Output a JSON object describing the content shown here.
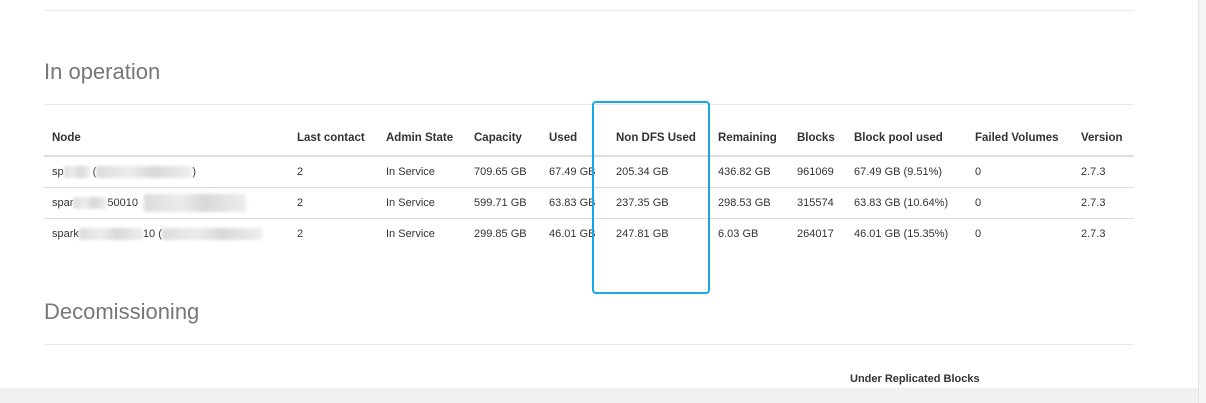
{
  "sections": {
    "in_operation": "In operation",
    "decommissioning": "Decomissioning"
  },
  "table": {
    "headers": [
      "Node",
      "Last contact",
      "Admin State",
      "Capacity",
      "Used",
      "Non DFS Used",
      "Remaining",
      "Blocks",
      "Block pool used",
      "Failed Volumes",
      "Version"
    ],
    "rows": [
      {
        "node_prefix": "sp",
        "node_mid": "",
        "node_suffix": ")",
        "last_contact": "2",
        "admin_state": "In Service",
        "capacity": "709.65 GB",
        "used": "67.49 GB",
        "non_dfs_used": "205.34 GB",
        "remaining": "436.82 GB",
        "blocks": "961069",
        "block_pool_used": "67.49 GB (9.51%)",
        "failed_volumes": "0",
        "version": "2.7.3"
      },
      {
        "node_prefix": "spar",
        "node_mid": "50010",
        "node_suffix": "",
        "last_contact": "2",
        "admin_state": "In Service",
        "capacity": "599.71 GB",
        "used": "63.83 GB",
        "non_dfs_used": "237.35 GB",
        "remaining": "298.53 GB",
        "blocks": "315574",
        "block_pool_used": "63.83 GB (10.64%)",
        "failed_volumes": "0",
        "version": "2.7.3"
      },
      {
        "node_prefix": "spark",
        "node_mid": "10",
        "node_suffix": "",
        "last_contact": "2",
        "admin_state": "In Service",
        "capacity": "299.85 GB",
        "used": "46.01 GB",
        "non_dfs_used": "247.81 GB",
        "remaining": "6.03 GB",
        "blocks": "264017",
        "block_pool_used": "46.01 GB (15.35%)",
        "failed_volumes": "0",
        "version": "2.7.3"
      }
    ]
  },
  "decommissioning_table": {
    "visible_header": "Under Replicated Blocks"
  },
  "highlight": {
    "color": "#1aa6e6",
    "column": "Non DFS Used"
  }
}
